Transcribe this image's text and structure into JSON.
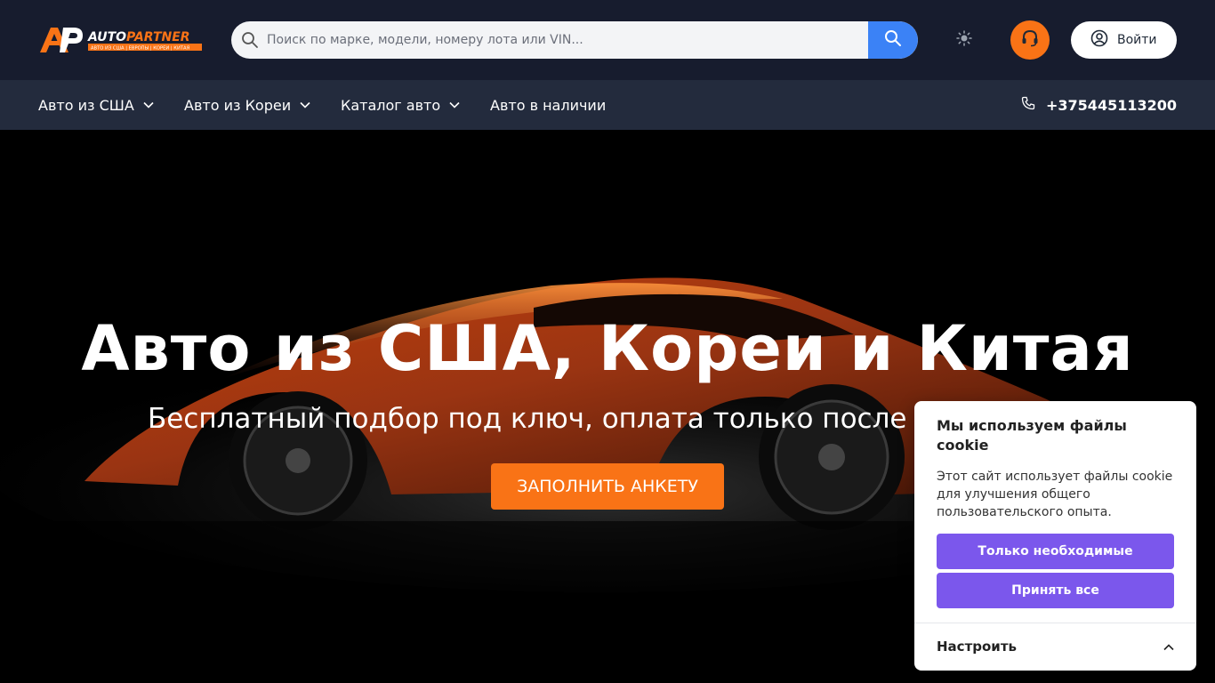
{
  "header": {
    "logo": {
      "brand": "AUTOPARTNER",
      "tagline": "АВТО ИЗ США | ЕВРОПЫ | КОРЕИ | КИТАЯ",
      "mark": "AP"
    },
    "search": {
      "placeholder": "Поиск по марке, модели, номеру лота или VIN..."
    },
    "login_label": "Войти",
    "colors": {
      "accent": "#f97316",
      "search_button": "#3b82f6",
      "topbar": "#171c2e",
      "navbar": "#232b3d"
    }
  },
  "nav": {
    "items": [
      {
        "label": "Авто из США",
        "has_dropdown": true
      },
      {
        "label": "Авто из Кореи",
        "has_dropdown": true
      },
      {
        "label": "Каталог авто",
        "has_dropdown": true
      },
      {
        "label": "Авто в наличии",
        "has_dropdown": false
      }
    ],
    "phone": "+375445113200"
  },
  "hero": {
    "title": "Авто из США, Кореи и Китая",
    "subtitle": "Бесплатный подбор под ключ, оплата только после выигрыша",
    "cta_label": "ЗАПОЛНИТЬ АНКЕТУ"
  },
  "cookie": {
    "title": "Мы используем файлы cookie",
    "text": "Этот сайт использует файлы cookie для улучшения общего пользовательского опыта.",
    "necessary_label": "Только необходимые",
    "accept_label": "Принять все",
    "configure_label": "Настроить",
    "button_color": "#7b57ec"
  }
}
